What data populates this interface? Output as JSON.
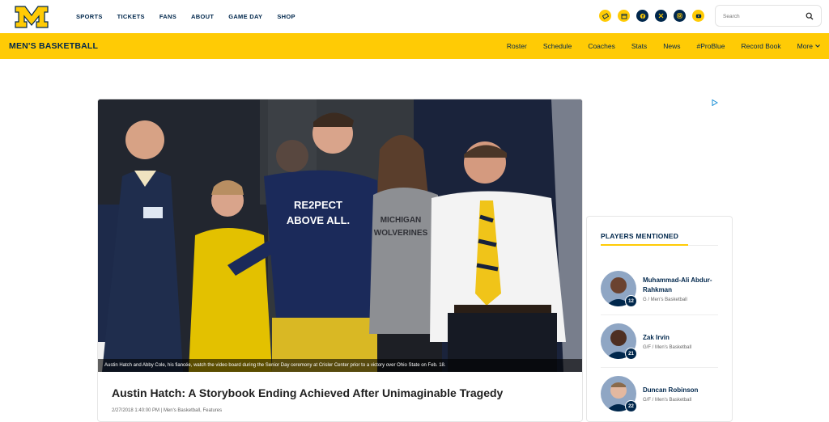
{
  "nav": {
    "items": [
      "SPORTS",
      "TICKETS",
      "FANS",
      "ABOUT",
      "GAME DAY",
      "SHOP"
    ]
  },
  "socials": [
    "tickets-icon",
    "calendar-icon",
    "facebook-icon",
    "x-icon",
    "instagram-icon",
    "youtube-icon"
  ],
  "search": {
    "placeholder": "Search"
  },
  "subnav": {
    "team": "MEN'S BASKETBALL",
    "items": [
      "Roster",
      "Schedule",
      "Coaches",
      "Stats",
      "News",
      "#ProBlue",
      "Record Book"
    ],
    "more": "More"
  },
  "article": {
    "caption": "Austin Hatch and Abby Cole, his fiancée, watch the video board during the Senior Day ceremony at Crisler Center prior to a victory over Ohio State on Feb. 18.",
    "title": "Austin Hatch: A Storybook Ending Achieved After Unimaginable Tragedy",
    "byline": "2/27/2018 1:40:00 PM | Men's Basketball, Features",
    "shirt_text_1": "RE2PECT",
    "shirt_text_2": "ABOVE ALL.",
    "shirt_text_3": "MICHIGAN",
    "shirt_text_4": "WOLVERINES"
  },
  "players_panel": {
    "title": "PLAYERS MENTIONED",
    "players": [
      {
        "name": "Muhammad-Ali Abdur-Rahkman",
        "number": "12",
        "position": "G / Men's Basketball"
      },
      {
        "name": "Zak Irvin",
        "number": "21",
        "position": "G/F / Men's Basketball"
      },
      {
        "name": "Duncan Robinson",
        "number": "22",
        "position": "G/F / Men's Basketball"
      }
    ]
  },
  "colors": {
    "maize": "#ffcb05",
    "blue": "#00274c"
  }
}
